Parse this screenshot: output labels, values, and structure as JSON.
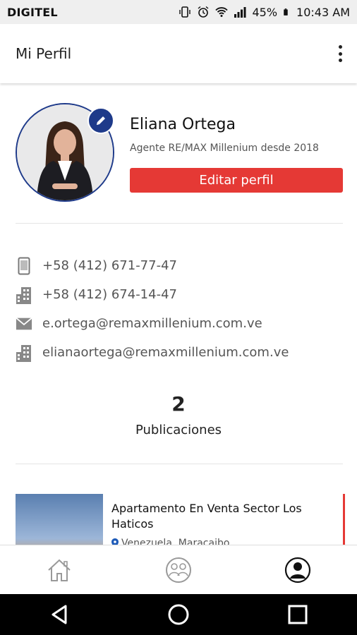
{
  "status_bar": {
    "carrier": "DIGITEL",
    "battery": "45%",
    "time": "10:43 AM"
  },
  "app_bar": {
    "title": "Mi Perfil",
    "menu_icon": "more-vert-icon"
  },
  "profile": {
    "name": "Eliana Ortega",
    "subtitle": "Agente RE/MAX Millenium desde 2018",
    "edit_button": "Editar perfil",
    "edit_badge_icon": "pencil-icon"
  },
  "contacts": [
    {
      "icon": "mobile-phone-icon",
      "value": "+58 (412) 671-77-47"
    },
    {
      "icon": "office-building-icon",
      "value": "+58 (412) 674-14-47"
    },
    {
      "icon": "mail-icon",
      "value": "e.ortega@remaxmillenium.com.ve"
    },
    {
      "icon": "office-building-icon",
      "value": "elianaortega@remaxmillenium.com.ve"
    }
  ],
  "stats": {
    "count": "2",
    "label": "Publicaciones"
  },
  "listing": {
    "title": "Apartamento En Venta Sector Los Haticos",
    "location": "Venezuela, Maracaibo"
  },
  "bottom_nav": [
    {
      "icon": "home-icon"
    },
    {
      "icon": "agents-icon"
    },
    {
      "icon": "profile-icon"
    }
  ],
  "colors": {
    "accent": "#e53935",
    "avatar_ring": "#1e3a8a"
  }
}
